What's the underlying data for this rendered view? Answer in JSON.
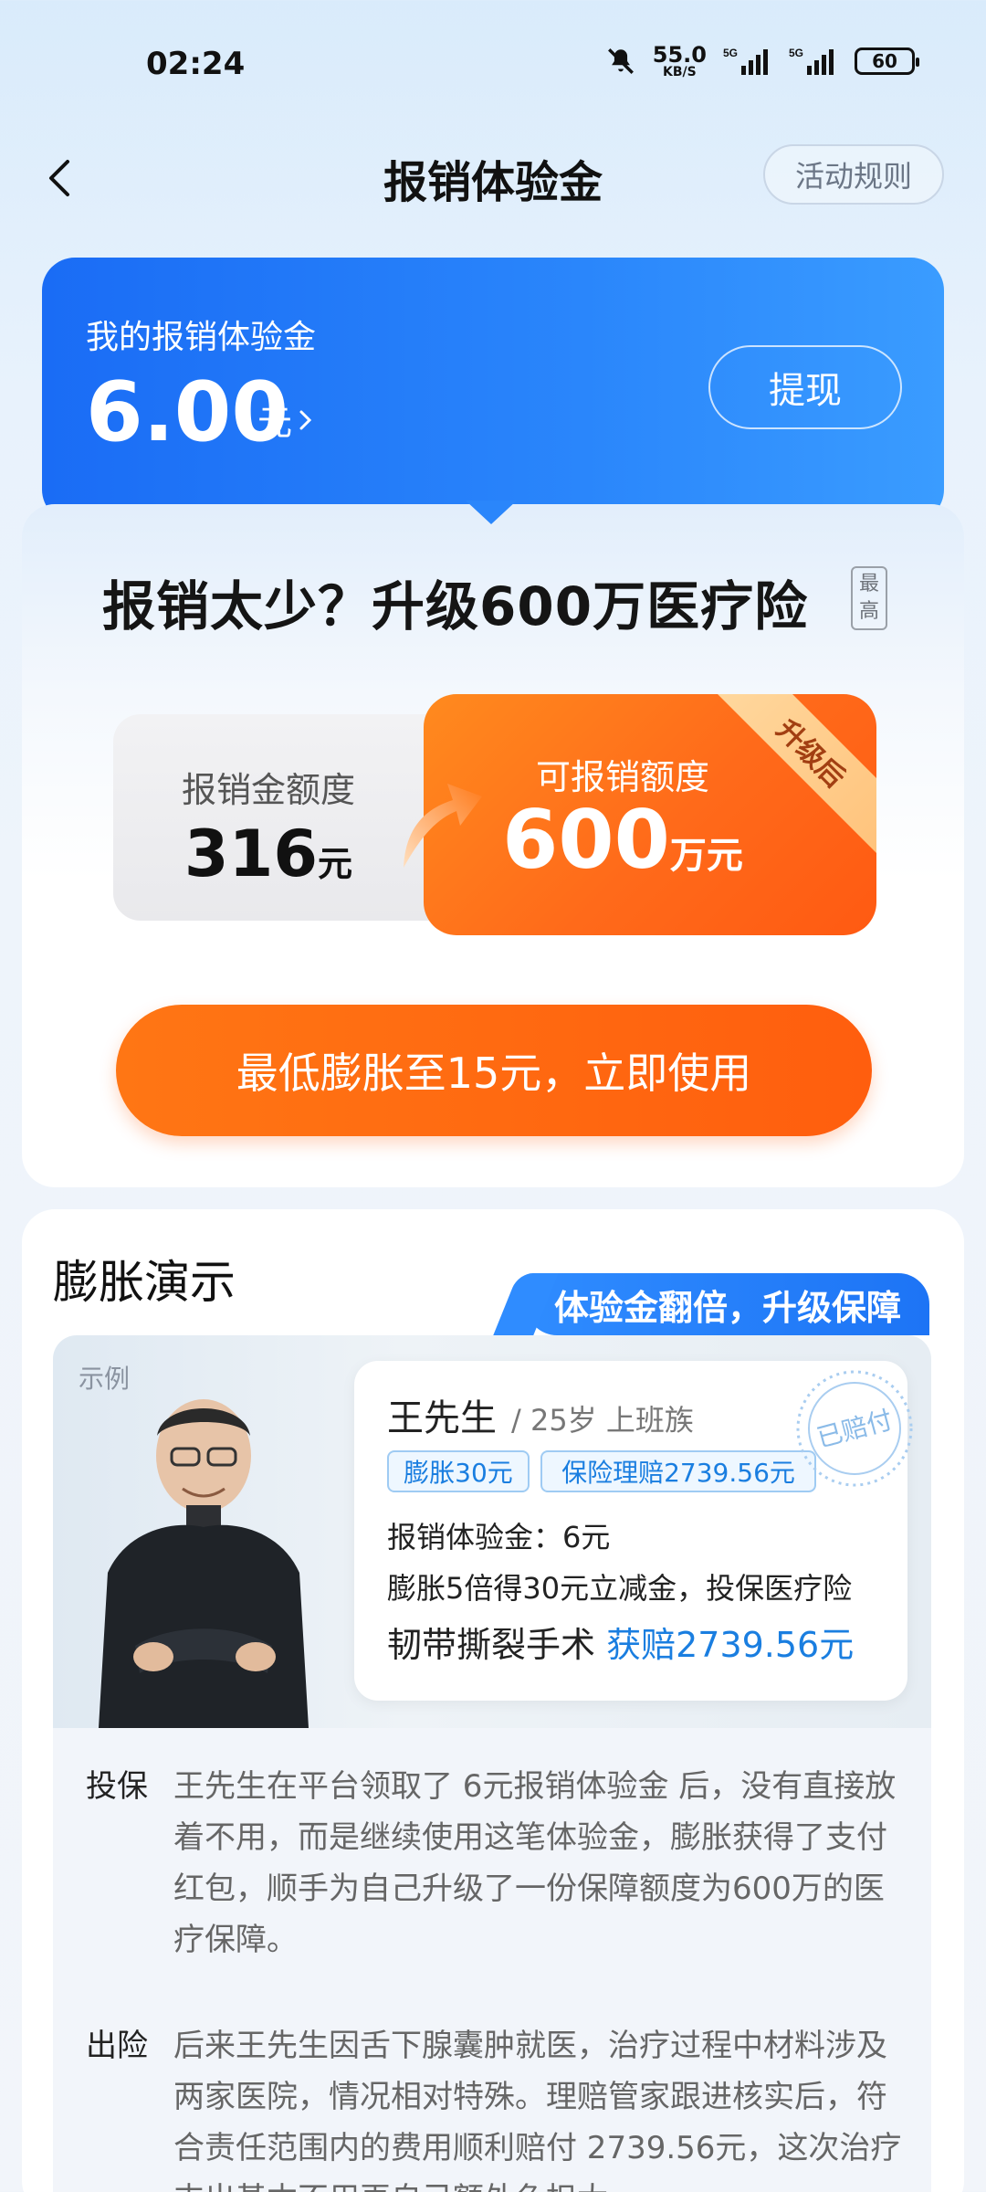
{
  "status_bar": {
    "time": "02:24",
    "net_speed": "55.0",
    "net_unit": "KB/S",
    "signal1": "5G",
    "signal2": "5G",
    "battery": "60"
  },
  "header": {
    "title": "报销体验金",
    "rules_label": "活动规则"
  },
  "balance": {
    "label": "我的报销体验金",
    "amount": "6.00",
    "unit": "元",
    "withdraw_label": "提现"
  },
  "upgrade": {
    "title": "报销太少？升级600万医疗险",
    "max_tag": "最高",
    "current_label": "报销金额度",
    "current_value": "316",
    "current_unit": "元",
    "upgraded_label": "可报销额度",
    "upgraded_value": "600",
    "upgraded_unit": "万元",
    "ribbon": "升级后",
    "use_button": "最低膨胀至15元，立即使用"
  },
  "demo": {
    "title": "膨胀演示",
    "banner": "体验金翻倍，升级保障",
    "example_tag": "示例",
    "name": "王先生",
    "meta": "/ 25岁  上班族",
    "chip_expand": "膨胀30元",
    "chip_claim": "保险理赔2739.56元",
    "line1": "报销体验金：6元",
    "line2": "膨胀5倍得30元立减金，投保医疗险",
    "line3_prefix": "韧带撕裂手术 ",
    "line3_claim": "获赔2739.56元",
    "stamp": "已赔付",
    "story": [
      {
        "label": "投保",
        "text": "王先生在平台领取了 6元报销体验金 后，没有直接放着不用，而是继续使用这笔体验金，膨胀获得了支付红包，顺手为自己升级了一份保障额度为600万的医疗保障。"
      },
      {
        "label": "出险",
        "text": "后来王先生因舌下腺囊肿就医，治疗过程中材料涉及两家医院，情况相对特殊。理赔管家跟进核实后，符合责任范围内的费用顺利赔付 2739.56元，这次治疗支出基本不用再自己额外负担太"
      }
    ]
  },
  "colors": {
    "brand_blue": "#1a6cf5",
    "accent_orange": "#ff6a1a",
    "link_blue": "#1a7ee0"
  }
}
